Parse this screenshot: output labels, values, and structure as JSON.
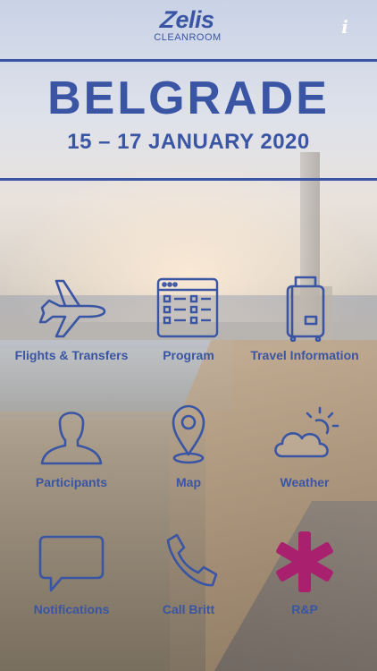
{
  "app": {
    "logo_mark": "elis",
    "logo_sub": "CLEANROOM",
    "info_label": "i"
  },
  "event": {
    "city": "BELGRADE",
    "dates": "15 – 17 JANUARY 2020"
  },
  "menu": [
    {
      "label": "Flights & Transfers",
      "icon": "airplane-icon"
    },
    {
      "label": "Program",
      "icon": "schedule-grid-icon"
    },
    {
      "label": "Travel Information",
      "icon": "luggage-icon"
    },
    {
      "label": "Participants",
      "icon": "person-icon"
    },
    {
      "label": "Map",
      "icon": "map-pin-icon"
    },
    {
      "label": "Weather",
      "icon": "cloud-sun-icon"
    },
    {
      "label": "Notifications",
      "icon": "speech-bubble-icon"
    },
    {
      "label": "Call Britt",
      "icon": "phone-icon"
    },
    {
      "label": "R&P",
      "icon": "asterisk-icon"
    }
  ],
  "colors": {
    "primary": "#3a55a4",
    "accent": "#a8206e",
    "info": "#ffffff"
  }
}
